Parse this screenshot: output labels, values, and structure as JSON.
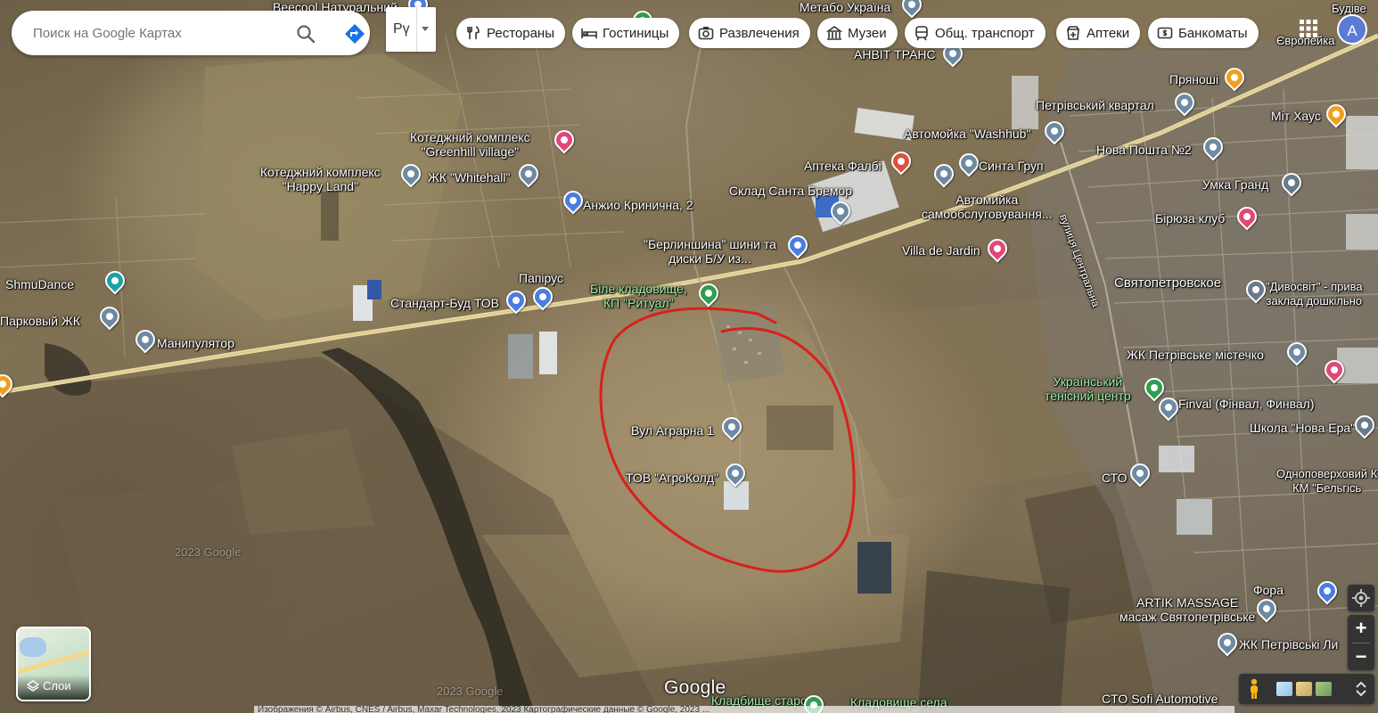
{
  "search": {
    "placeholder": "Поиск на Google Картах",
    "search_icon": "search-icon",
    "directions_icon": "directions-icon"
  },
  "language": {
    "value": "Рү"
  },
  "chips": [
    {
      "label": "Рестораны",
      "icon": "restaurant-icon"
    },
    {
      "label": "Гостиницы",
      "icon": "hotel-icon"
    },
    {
      "label": "Развлечения",
      "icon": "camera-icon"
    },
    {
      "label": "Музеи",
      "icon": "museum-icon"
    },
    {
      "label": "Общ. транспорт",
      "icon": "transit-icon"
    },
    {
      "label": "Аптеки",
      "icon": "pharmacy-icon"
    },
    {
      "label": "Банкоматы",
      "icon": "atm-icon"
    }
  ],
  "account": {
    "initial": "A"
  },
  "map": {
    "places": [
      {
        "name": "Beecool Натуральний",
        "kind": "place"
      },
      {
        "name": "Метабо Україна",
        "kind": "place"
      },
      {
        "name": "Будіве",
        "kind": "place"
      },
      {
        "name": "Європейка",
        "kind": "place"
      },
      {
        "name": "АНВІТ ТРАНС",
        "kind": "place"
      },
      {
        "name": "Пряноші",
        "kind": "restaurant"
      },
      {
        "name": "Петрівський квартал",
        "kind": "place"
      },
      {
        "name": "Міт Хаус",
        "kind": "restaurant"
      },
      {
        "name": "Котеджний комплекс \"Greenhill village\"",
        "kind": "hotel"
      },
      {
        "name": "Автомойка \"Washhub\"",
        "kind": "place"
      },
      {
        "name": "Нова Пошта №2",
        "kind": "place"
      },
      {
        "name": "Котеджний комплекс \"Happy Land\"",
        "kind": "place"
      },
      {
        "name": "ЖК \"Whitehall\"",
        "kind": "place"
      },
      {
        "name": "Аптека Фалбі",
        "kind": "pharmacy"
      },
      {
        "name": "Синта Груп",
        "kind": "place"
      },
      {
        "name": "Склад Санта Бремор",
        "kind": "place"
      },
      {
        "name": "Умка Гранд",
        "kind": "school"
      },
      {
        "name": "Анжио Кринична, 2",
        "kind": "shop"
      },
      {
        "name": "Автомийка самообслуговування...",
        "kind": "place"
      },
      {
        "name": "Бірюза клуб",
        "kind": "hotel"
      },
      {
        "name": "\"Берлиншина\" шини та диски Б/У из...",
        "kind": "shop"
      },
      {
        "name": "Villa de Jardin",
        "kind": "hotel"
      },
      {
        "name": "ShmuDance",
        "kind": "place"
      },
      {
        "name": "Папірус",
        "kind": "shop"
      },
      {
        "name": "Стандарт-Буд ТОВ",
        "kind": "shop"
      },
      {
        "name": "Біле кладовище, КП \"Ритуал\"",
        "kind": "park"
      },
      {
        "name": "Святопетровское",
        "kind": "locality"
      },
      {
        "name": "\"Дивосвіт\" - прива заклад дошкільно",
        "kind": "school"
      },
      {
        "name": "Парковый ЖК",
        "kind": "place"
      },
      {
        "name": "Манипулятор",
        "kind": "place"
      },
      {
        "name": "ЖК Петрівське містечко",
        "kind": "place"
      },
      {
        "name": "Український тенісний центр",
        "kind": "park"
      },
      {
        "name": "Finval (Фінвал, Финвал)",
        "kind": "place"
      },
      {
        "name": "Вул Аграрна 1",
        "kind": "place"
      },
      {
        "name": "Школа \"Нова Ера\"",
        "kind": "school"
      },
      {
        "name": "ТОВ \"АгроКолд\"",
        "kind": "place"
      },
      {
        "name": "СТО",
        "kind": "place"
      },
      {
        "name": "Одноповерховий К КМ \"Бельгісь",
        "kind": "place"
      },
      {
        "name": "ARTIK MASSAGE масаж Святопетрівське",
        "kind": "place"
      },
      {
        "name": "Фора",
        "kind": "shop"
      },
      {
        "name": "ЖК Петрівські Ли",
        "kind": "place"
      },
      {
        "name": "Кладбище старое",
        "kind": "park"
      },
      {
        "name": "Кладовище села",
        "kind": "park"
      },
      {
        "name": "CTO Sofi Automotive",
        "kind": "place"
      }
    ],
    "road_street": "вулиця Центральна",
    "watermarks": [
      "2023 Google",
      "2023 Google"
    ]
  },
  "layers": {
    "label": "Слои"
  },
  "controls": {
    "zoom_in": "+",
    "zoom_out": "−"
  },
  "google_logo": "Google",
  "footer": "Изображения © Airbus, CNES / Airbus, Maxar Technologies, 2023 Картографические данные © Google, 2023 ..."
}
